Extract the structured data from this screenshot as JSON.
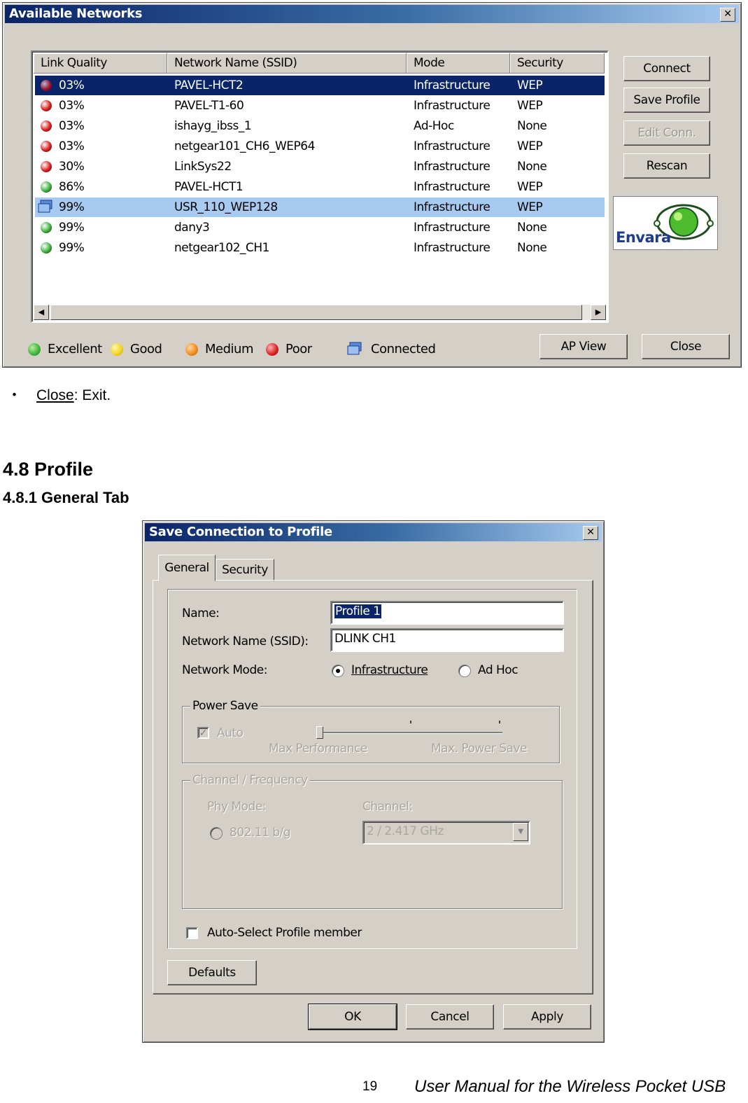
{
  "networks_window": {
    "title": "Available Networks",
    "columns": [
      "Link Quality",
      "Network Name (SSID)",
      "Mode",
      "Security"
    ],
    "rows": [
      {
        "quality": "03%",
        "ssid": "PAVEL-HCT2",
        "mode": "Infrastructure",
        "security": "WEP",
        "state": "selected"
      },
      {
        "quality": "03%",
        "ssid": "PAVEL-T1-60",
        "mode": "Infrastructure",
        "security": "WEP",
        "state": "poor"
      },
      {
        "quality": "03%",
        "ssid": "ishayg_ibss_1",
        "mode": "Ad-Hoc",
        "security": "None",
        "state": "poor"
      },
      {
        "quality": "03%",
        "ssid": "netgear101_CH6_WEP64",
        "mode": "Infrastructure",
        "security": "WEP",
        "state": "poor"
      },
      {
        "quality": "30%",
        "ssid": "LinkSys22",
        "mode": "Infrastructure",
        "security": "None",
        "state": "poor"
      },
      {
        "quality": "86%",
        "ssid": "PAVEL-HCT1",
        "mode": "Infrastructure",
        "security": "WEP",
        "state": "excellent"
      },
      {
        "quality": "99%",
        "ssid": "USR_110_WEP128",
        "mode": "Infrastructure",
        "security": "WEP",
        "state": "connected"
      },
      {
        "quality": "99%",
        "ssid": "dany3",
        "mode": "Infrastructure",
        "security": "None",
        "state": "excellent"
      },
      {
        "quality": "99%",
        "ssid": "netgear102_CH1",
        "mode": "Infrastructure",
        "security": "None",
        "state": "excellent"
      }
    ],
    "buttons": {
      "connect": "Connect",
      "save_profile": "Save Profile",
      "edit_conn": "Edit Conn.",
      "rescan": "Rescan",
      "ap_view": "AP View",
      "close": "Close"
    },
    "logo_text": "Envara",
    "legend": {
      "excellent": "Excellent",
      "good": "Good",
      "medium": "Medium",
      "poor": "Poor",
      "connected": "Connected"
    },
    "colors": {
      "excellent": "#3bb33b",
      "good": "#f2d21a",
      "medium": "#f08a1a",
      "poor": "#d81e1e",
      "selected_row": "#0a246a",
      "connected_row": "#a6caf0"
    }
  },
  "text": {
    "bullet_term": "Close",
    "bullet_rest": ": Exit.",
    "section_heading": "4.8 Profile",
    "subsection_heading": "4.8.1 General Tab"
  },
  "profile_dialog": {
    "title": "Save Connection to Profile",
    "tabs": [
      "General",
      "Security"
    ],
    "name_label": "Name:",
    "name_value": "Profile 1",
    "ssid_label": "Network Name (SSID):",
    "ssid_value": "DLINK CH1",
    "mode_label": "Network Mode:",
    "mode_infrastructure": "Infrastructure",
    "mode_adhoc": "Ad Hoc",
    "power_save_label": "Power Save",
    "auto_label": "Auto",
    "max_performance": "Max Performance",
    "max_power_save": "Max. Power Save",
    "channel_group_label": "Channel / Frequency",
    "phy_mode_label": "Phy Mode:",
    "phy_mode_value": "802.11 b/g",
    "channel_label": "Channel:",
    "channel_value": "2 / 2.417 GHz",
    "auto_select_label": "Auto-Select Profile member",
    "buttons": {
      "defaults": "Defaults",
      "ok": "OK",
      "cancel": "Cancel",
      "apply": "Apply"
    }
  },
  "footer": {
    "page_number": "19",
    "manual_title": "User Manual for the Wireless Pocket USB"
  }
}
